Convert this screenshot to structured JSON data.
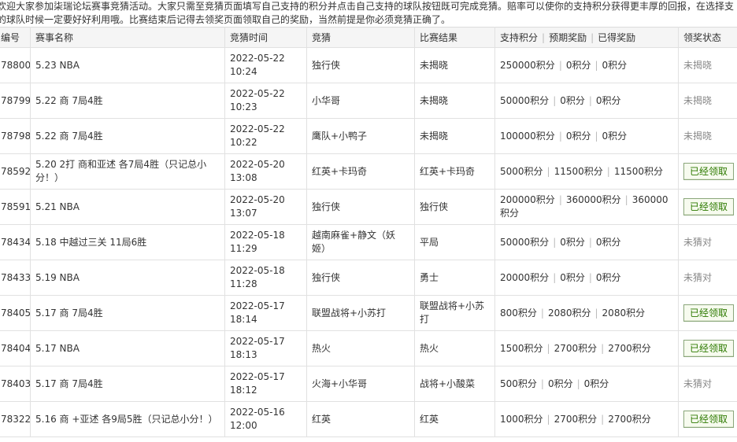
{
  "intro": {
    "line1": "欢迎大家参加柒瑞论坛赛事竞猜活动。大家只需至竞猜页面填写自己支持的积分并点击自己支持的球队按钮既可完成竞猜。赔率可以使你的支持积分获得更丰厚的回报，在选择支",
    "line2": "的球队时候一定要好好利用哦。比赛结束后记得去领奖页面领取自己的奖励，当然前提是你必须竞猜正确了。"
  },
  "table": {
    "headers": {
      "id": "编号",
      "name": "赛事名称",
      "time": "竞猜时间",
      "guess": "竞猜",
      "result": "比赛结果",
      "support": "支持积分",
      "expected": "预期奖励",
      "earned": "已得奖励",
      "status": "领奖状态"
    },
    "rows": [
      {
        "id": "78800",
        "name": "5.23 NBA",
        "date": "2022-05-22",
        "clock": "10:24",
        "guess": "独行侠",
        "result": "未揭晓",
        "support": "250000积分",
        "expected": "0积分",
        "earned": "0积分",
        "status": "未揭晓",
        "claimable": false
      },
      {
        "id": "78799",
        "name": "5.22 商 7局4胜",
        "date": "2022-05-22",
        "clock": "10:23",
        "guess": "小华哥",
        "result": "未揭晓",
        "support": "50000积分",
        "expected": "0积分",
        "earned": "0积分",
        "status": "未揭晓",
        "claimable": false
      },
      {
        "id": "78798",
        "name": "5.22 商 7局4胜",
        "date": "2022-05-22",
        "clock": "10:22",
        "guess": "鹰队+小鸭子",
        "result": "未揭晓",
        "support": "100000积分",
        "expected": "0积分",
        "earned": "0积分",
        "status": "未揭晓",
        "claimable": false
      },
      {
        "id": "78592",
        "name": "5.20 2打 商和亚述 各7局4胜（只记总小分！）",
        "date": "2022-05-20",
        "clock": "13:08",
        "guess": "红英+卡玛奇",
        "result": "红英+卡玛奇",
        "support": "5000积分",
        "expected": "11500积分",
        "earned": "11500积分",
        "status": "已经领取",
        "claimable": true
      },
      {
        "id": "78591",
        "name": "5.21 NBA",
        "date": "2022-05-20",
        "clock": "13:07",
        "guess": "独行侠",
        "result": "独行侠",
        "support": "200000积分",
        "expected": "360000积分",
        "earned": "360000积分",
        "status": "已经领取",
        "claimable": true
      },
      {
        "id": "78434",
        "name": "5.18 中越过三关 11局6胜",
        "date": "2022-05-18",
        "clock": "11:29",
        "guess": "越南麻雀+静文（妖姬）",
        "result": "平局",
        "support": "50000积分",
        "expected": "0积分",
        "earned": "0积分",
        "status": "未猜对",
        "claimable": false
      },
      {
        "id": "78433",
        "name": "5.19 NBA",
        "date": "2022-05-18",
        "clock": "11:28",
        "guess": "独行侠",
        "result": "勇士",
        "support": "20000积分",
        "expected": "0积分",
        "earned": "0积分",
        "status": "未猜对",
        "claimable": false
      },
      {
        "id": "78405",
        "name": "5.17 商 7局4胜",
        "date": "2022-05-17",
        "clock": "18:14",
        "guess": "联盟战将+小苏打",
        "result": "联盟战将+小苏打",
        "support": "800积分",
        "expected": "2080积分",
        "earned": "2080积分",
        "status": "已经领取",
        "claimable": true
      },
      {
        "id": "78404",
        "name": "5.17 NBA",
        "date": "2022-05-17",
        "clock": "18:13",
        "guess": "热火",
        "result": "热火",
        "support": "1500积分",
        "expected": "2700积分",
        "earned": "2700积分",
        "status": "已经领取",
        "claimable": true
      },
      {
        "id": "78403",
        "name": "5.17 商 7局4胜",
        "date": "2022-05-17",
        "clock": "18:12",
        "guess": "火海+小华哥",
        "result": "战将+小酸菜",
        "support": "500积分",
        "expected": "0积分",
        "earned": "0积分",
        "status": "未猜对",
        "claimable": false
      },
      {
        "id": "78322",
        "name": "5.16 商 +亚述 各9局5胜（只记总小分！）",
        "date": "2022-05-16",
        "clock": "12:00",
        "guess": "红英",
        "result": "红英",
        "support": "1000积分",
        "expected": "2700积分",
        "earned": "2700积分",
        "status": "已经领取",
        "claimable": true
      }
    ]
  }
}
